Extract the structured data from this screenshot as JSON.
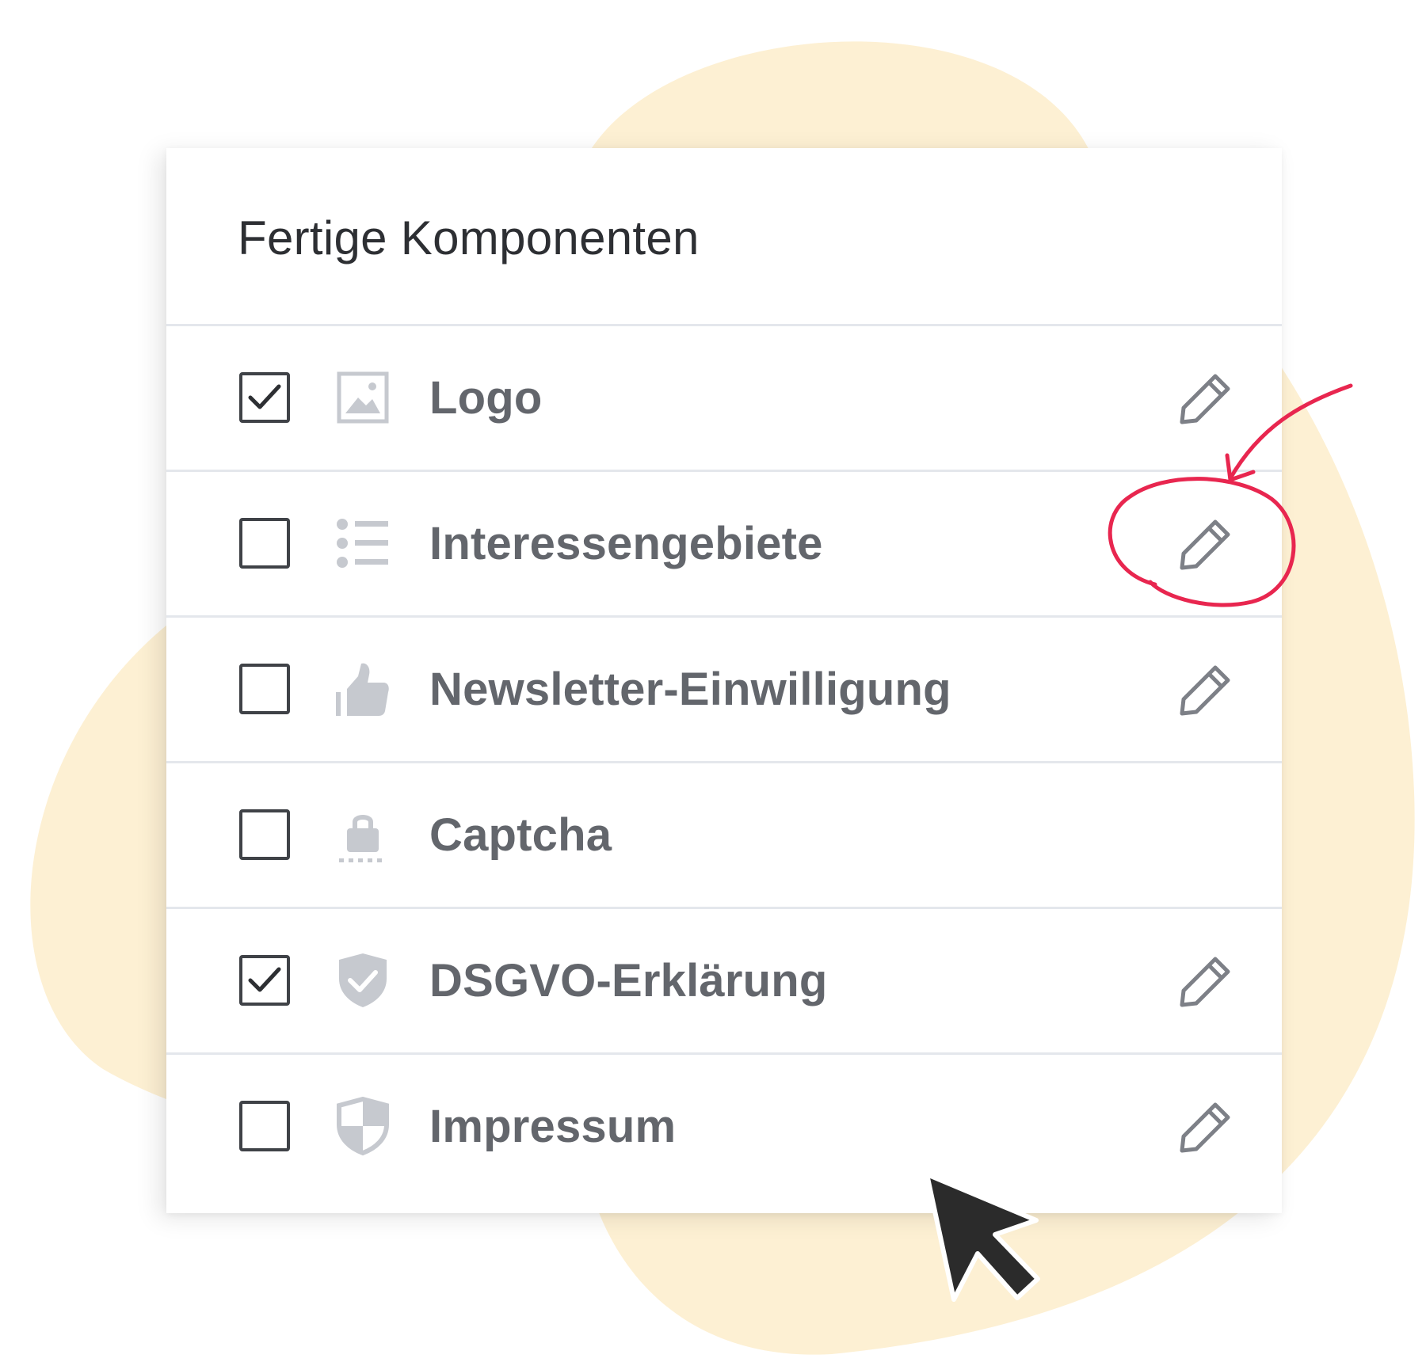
{
  "panel": {
    "title": "Fertige Komponenten"
  },
  "components": [
    {
      "label": "Logo",
      "checked": true,
      "icon": "image-icon",
      "editable": true
    },
    {
      "label": "Interessengebiete",
      "checked": false,
      "icon": "list-icon",
      "editable": true
    },
    {
      "label": "Newsletter-Einwilligung",
      "checked": false,
      "icon": "thumbs-up-icon",
      "editable": true
    },
    {
      "label": "Captcha",
      "checked": false,
      "icon": "lock-icon",
      "editable": false
    },
    {
      "label": "DSGVO-Erklärung",
      "checked": true,
      "icon": "shield-check-icon",
      "editable": true
    },
    {
      "label": "Impressum",
      "checked": false,
      "icon": "shield-icon",
      "editable": true
    }
  ],
  "colors": {
    "background_blob": "#fdf0d3",
    "annotation": "#e8264f",
    "text_primary": "#2d2f33",
    "text_label": "#63666c",
    "icon_muted": "#c6c9cf",
    "edit_icon": "#7d8087",
    "divider": "#e4e7ec"
  }
}
